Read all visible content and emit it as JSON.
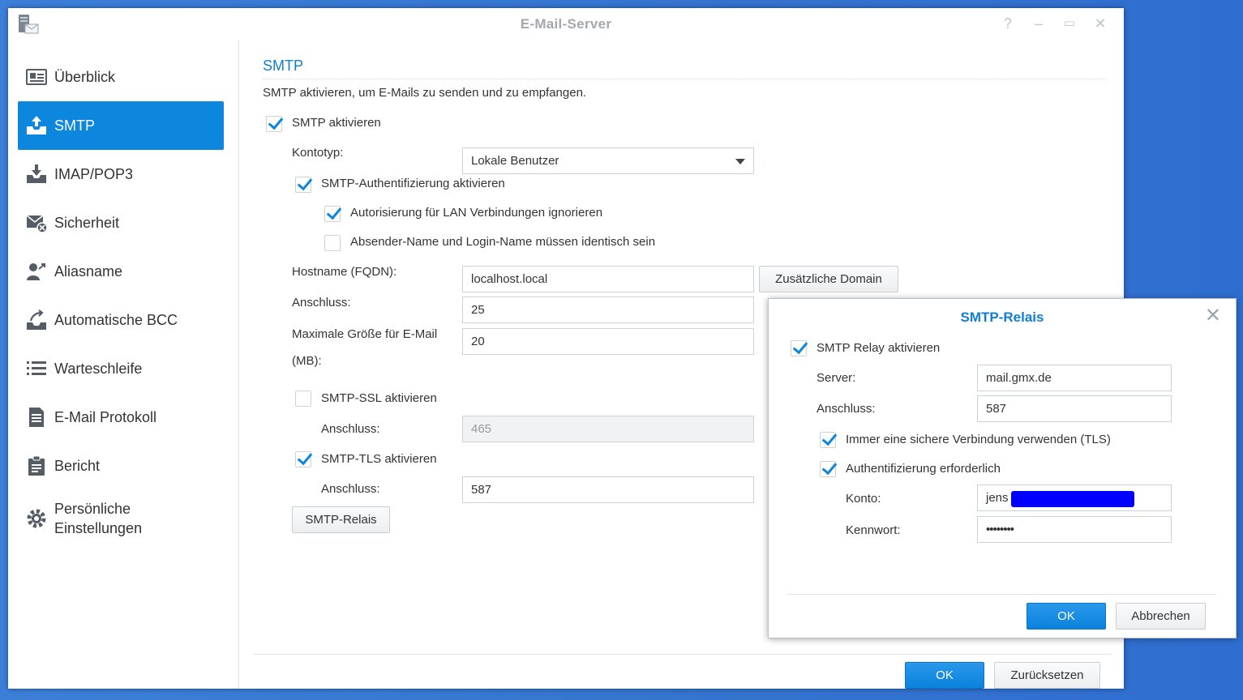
{
  "window": {
    "title": "E-Mail-Server",
    "controls": [
      "help-icon",
      "minimize-icon",
      "maximize-icon",
      "close-icon"
    ]
  },
  "sidebar": {
    "items": [
      {
        "label": "Überblick",
        "icon": "overview-icon",
        "active": false
      },
      {
        "label": "SMTP",
        "icon": "smtp-icon",
        "active": true
      },
      {
        "label": "IMAP/POP3",
        "icon": "imap-icon",
        "active": false
      },
      {
        "label": "Sicherheit",
        "icon": "security-icon",
        "active": false
      },
      {
        "label": "Aliasname",
        "icon": "alias-icon",
        "active": false
      },
      {
        "label": "Automatische BCC",
        "icon": "bcc-icon",
        "active": false
      },
      {
        "label": "Warteschleife",
        "icon": "queue-icon",
        "active": false
      },
      {
        "label": "E-Mail Protokoll",
        "icon": "log-icon",
        "active": false
      },
      {
        "label": "Bericht",
        "icon": "report-icon",
        "active": false
      },
      {
        "label": "Persönliche",
        "label2": "Einstellungen",
        "icon": "settings-gear-icon",
        "active": false
      }
    ]
  },
  "main": {
    "heading": "SMTP",
    "description": "SMTP aktivieren, um E-Mails zu senden und zu empfangen.",
    "enable_smtp": {
      "label": "SMTP aktivieren",
      "checked": true
    },
    "account_type": {
      "label": "Kontotyp:",
      "value": "Lokale Benutzer"
    },
    "smtp_auth": {
      "label": "SMTP-Authentifizierung aktivieren",
      "checked": true
    },
    "ignore_lan": {
      "label": "Autorisierung für LAN Verbindungen ignorieren",
      "checked": true
    },
    "sender_identical": {
      "label": "Absender-Name und Login-Name müssen identisch sein",
      "checked": false
    },
    "hostname": {
      "label": "Hostname (FQDN):",
      "value": "localhost.local",
      "button": "Zusätzliche Domain"
    },
    "port": {
      "label": "Anschluss:",
      "value": "25"
    },
    "max_size": {
      "label_line1": "Maximale Größe für E-Mail",
      "label_line2": "(MB):",
      "value": "20"
    },
    "ssl": {
      "label": "SMTP-SSL aktivieren",
      "checked": false,
      "port_label": "Anschluss:",
      "port_value": "465"
    },
    "tls": {
      "label": "SMTP-TLS aktivieren",
      "checked": true,
      "port_label": "Anschluss:",
      "port_value": "587"
    },
    "relay_button": "SMTP-Relais"
  },
  "footer": {
    "ok": "OK",
    "reset": "Zurücksetzen"
  },
  "dialog": {
    "title": "SMTP-Relais",
    "enable_relay": {
      "label": "SMTP Relay aktivieren",
      "checked": true
    },
    "server": {
      "label": "Server:",
      "value": "mail.gmx.de"
    },
    "port": {
      "label": "Anschluss:",
      "value": "587"
    },
    "tls": {
      "label": "Immer eine sichere Verbindung verwenden (TLS)",
      "checked": true
    },
    "auth": {
      "label": "Authentifizierung erforderlich",
      "checked": true
    },
    "account": {
      "label": "Konto:",
      "value": "jens"
    },
    "password": {
      "label": "Kennwort:",
      "value": "••••••••"
    },
    "ok": "OK",
    "cancel": "Abbrechen"
  },
  "colors": {
    "accent": "#0d86dd",
    "heading": "#0f7fd5",
    "redaction": "#0000ff"
  }
}
